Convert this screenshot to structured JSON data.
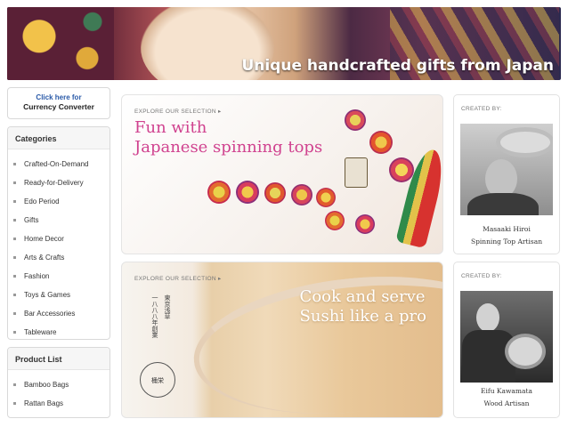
{
  "banner": {
    "tagline": "Unique handcrafted gifts from Japan"
  },
  "currency": {
    "link": "Click here for",
    "label": "Currency Converter"
  },
  "categories": {
    "title": "Categories",
    "items": [
      "Crafted-On-Demand",
      "Ready-for-Delivery",
      "Edo Period",
      "Gifts",
      "Home Decor",
      "Arts & Crafts",
      "Fashion",
      "Toys & Games",
      "Bar Accessories",
      "Tableware"
    ]
  },
  "products": {
    "title": "Product List",
    "items": [
      "Bamboo Bags",
      "Rattan Bags"
    ]
  },
  "features": [
    {
      "explore": "EXPLORE OUR SELECTION ▸",
      "line1": "Fun with",
      "line2": "Japanese spinning tops"
    },
    {
      "explore": "EXPLORE OUR SELECTION ▸",
      "line1": "Cook and serve",
      "line2": "Sushi like a pro",
      "seal": "桶栄",
      "vtext1": "東京浅草",
      "vtext2": "一八八八年創業"
    }
  ],
  "artisans": [
    {
      "created": "CREATED BY:",
      "name": "Masaaki Hiroi",
      "role": "Spinning Top Artisan"
    },
    {
      "created": "CREATED BY:",
      "name": "Eifu Kawamata",
      "role": "Wood Artisan"
    }
  ],
  "colors": {
    "headline_pink": "#d0428f",
    "link_blue": "#2a5aa8"
  }
}
